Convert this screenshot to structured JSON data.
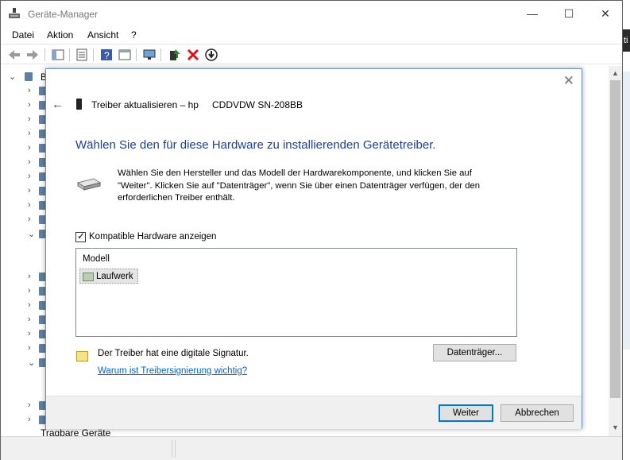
{
  "window": {
    "title": "Geräte-Manager",
    "controls": {
      "minimize": "—",
      "maximize": "☐",
      "close": "✕"
    }
  },
  "menu": {
    "items": [
      "Datei",
      "Aktion",
      "Ansicht",
      "?"
    ]
  },
  "toolbar": {
    "icons": [
      "back-arrow-icon",
      "forward-arrow-icon",
      "show-hide-console-tree-icon",
      "properties-icon",
      "help-icon",
      "console-view-icon",
      "monitor-icon",
      "update-driver-icon",
      "uninstall-device-icon",
      "disable-device-icon"
    ],
    "colors": {
      "uninstall": "#e01010",
      "update": "#2a8a2a"
    }
  },
  "tree": {
    "root_label": "B",
    "partial_row_label": "Tragbare Geräte"
  },
  "dialog": {
    "close_glyph": "✕",
    "back_glyph": "←",
    "wizard_title": "Treiber aktualisieren – hp",
    "device_name": "CDDVDW SN-208BB",
    "heading": "Wählen Sie den für diese Hardware zu installierenden Gerätetreiber.",
    "heading_color": "#1d3f95",
    "instruction": "Wählen Sie den Hersteller und das Modell der Hardwarekomponente, und klicken Sie auf \"Weiter\". Klicken Sie auf \"Datenträger\", wenn Sie über einen Datenträger verfügen, der den erforderlichen Treiber enthält.",
    "compatible_checkbox": {
      "label": "Kompatible Hardware anzeigen",
      "checked": true
    },
    "model_list": {
      "header": "Modell",
      "items": [
        "Laufwerk"
      ],
      "selected": "Laufwerk"
    },
    "signature_text": "Der Treiber hat eine digitale Signatur.",
    "signature_link": "Warum ist Treibersignierung wichtig?",
    "disk_button": "Datenträger...",
    "next_button": "Weiter",
    "cancel_button": "Abbrechen"
  },
  "right_sliver": {
    "text": "ti"
  }
}
